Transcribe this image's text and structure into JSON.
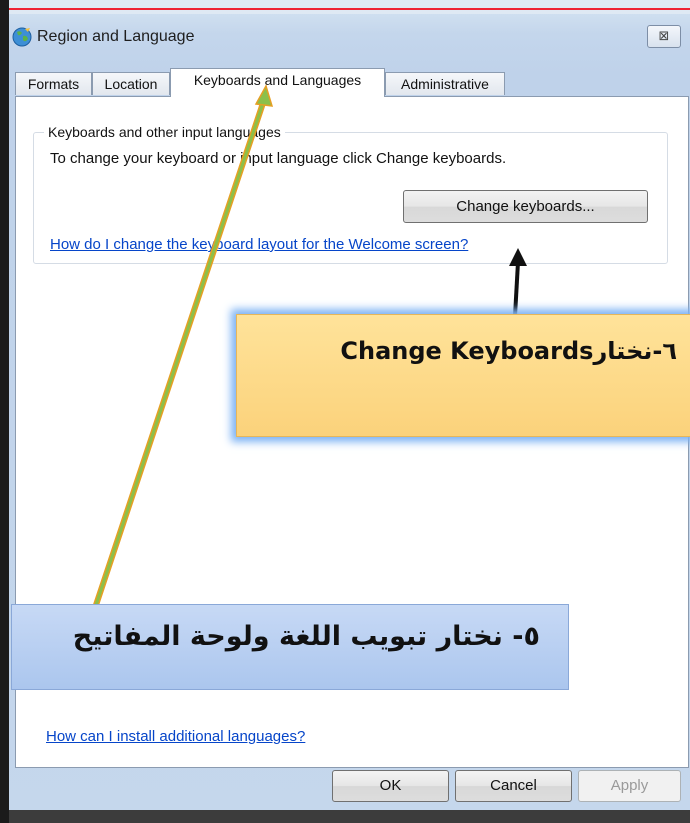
{
  "window": {
    "title": "Region and Language",
    "close_glyph": "⊠"
  },
  "tabs": [
    {
      "label": "Formats",
      "active": false
    },
    {
      "label": "Location",
      "active": false
    },
    {
      "label": "Keyboards and Languages",
      "active": true
    },
    {
      "label": "Administrative",
      "active": false
    }
  ],
  "group": {
    "title": "Keyboards and other input languages",
    "description": "To change your keyboard or input language click Change keyboards.",
    "change_button": "Change keyboards...",
    "welcome_link": "How do I change the keyboard layout for the Welcome screen?"
  },
  "install_link": "How can I install additional languages?",
  "buttons": {
    "ok": "OK",
    "cancel": "Cancel",
    "apply": "Apply"
  },
  "annotations": {
    "step6": "٦-نختارChange Keyboards",
    "step5": "٥- نختار تبويب اللغة ولوحة المفاتيح"
  },
  "colors": {
    "link": "#0645c9",
    "callout6_fill": "#fbd27b",
    "callout5_fill": "#abc6ee",
    "green_arrow": "#8cc04a"
  },
  "icons": {
    "app": "globe-icon",
    "close": "close-icon"
  }
}
